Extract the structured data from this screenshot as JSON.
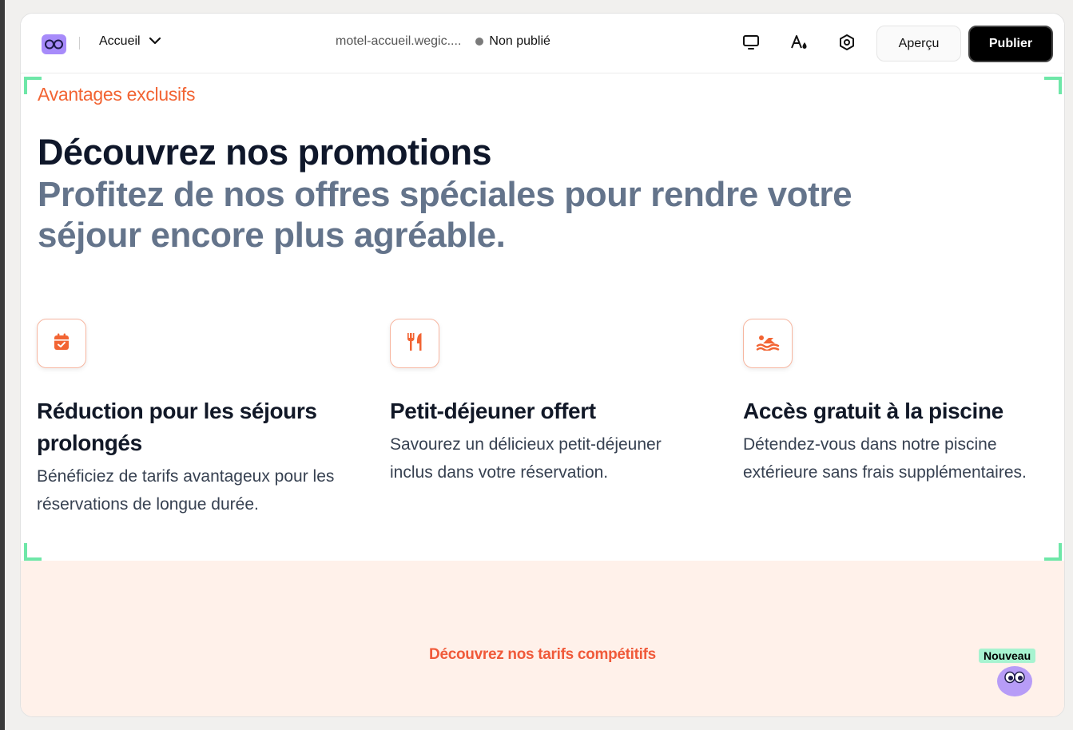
{
  "topbar": {
    "page_select_label": "Accueil",
    "url": "motel-accueil.wegic....",
    "status_label": "Non publié",
    "preview_label": "Aperçu",
    "publish_label": "Publier"
  },
  "section": {
    "eyebrow": "Avantages exclusifs",
    "title": "Découvrez nos promotions",
    "subtitle": "Profitez de nos offres spéciales pour rendre votre séjour encore plus agréable."
  },
  "features": [
    {
      "icon": "calendar-check-icon",
      "title": "Réduction pour les séjours prolongés",
      "description": "Bénéficiez de tarifs avantageux pour les réservations de longue durée."
    },
    {
      "icon": "utensils-icon",
      "title": "Petit-déjeuner offert",
      "description": "Savourez un délicieux petit-déjeuner inclus dans votre réservation."
    },
    {
      "icon": "swimmer-icon",
      "title": "Accès gratuit à la piscine",
      "description": "Détendez-vous dans notre piscine extérieure sans frais supplémentaires."
    }
  ],
  "next_section": {
    "cta_text": "Découvrez nos tarifs compétitifs"
  },
  "assistant": {
    "badge": "Nouveau"
  },
  "colors": {
    "accent": "#f26433",
    "publish_bg": "#000000",
    "band_bg": "#fff1ea",
    "selection_corners": "#6ee7a8"
  }
}
